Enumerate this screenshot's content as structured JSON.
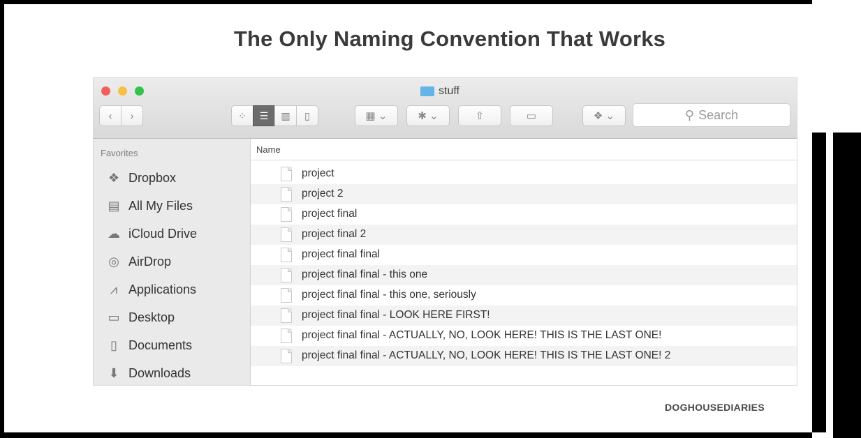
{
  "comic": {
    "title": "The Only Naming Convention That Works",
    "credit": "DOGHOUSEDIARIES"
  },
  "window": {
    "folder_title": "stuff",
    "search_placeholder": "Search",
    "traffic_light_colors": [
      "#f25f5a",
      "#f7c045",
      "#33c24a"
    ]
  },
  "sidebar": {
    "heading": "Favorites",
    "items": [
      {
        "label": "Dropbox",
        "icon": "dropbox-icon"
      },
      {
        "label": "All My Files",
        "icon": "all-files-icon"
      },
      {
        "label": "iCloud Drive",
        "icon": "cloud-icon"
      },
      {
        "label": "AirDrop",
        "icon": "airdrop-icon"
      },
      {
        "label": "Applications",
        "icon": "applications-icon"
      },
      {
        "label": "Desktop",
        "icon": "desktop-icon"
      },
      {
        "label": "Documents",
        "icon": "documents-icon"
      },
      {
        "label": "Downloads",
        "icon": "downloads-icon"
      }
    ]
  },
  "list": {
    "column_header": "Name",
    "files": [
      "project",
      "project 2",
      "project final",
      "project final 2",
      "project final final",
      "project final final - this one",
      "project final final - this one, seriously",
      "project final final - LOOK HERE FIRST!",
      "project final final - ACTUALLY, NO, LOOK HERE! THIS IS THE LAST ONE!",
      "project final final - ACTUALLY, NO, LOOK HERE! THIS IS THE LAST ONE! 2"
    ]
  }
}
